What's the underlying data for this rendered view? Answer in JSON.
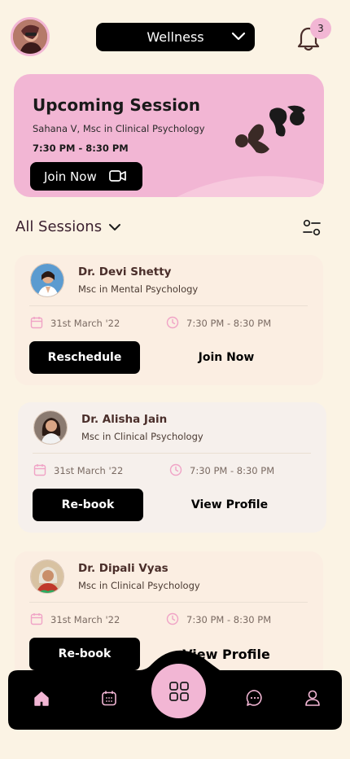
{
  "header": {
    "category": "Wellness",
    "notification_count": "3"
  },
  "upcoming": {
    "title": "Upcoming Session",
    "subtitle": "Sahana V, Msc in Clinical Psychology",
    "time": "7:30 PM - 8:30 PM",
    "join_label": "Join Now"
  },
  "sessions": {
    "label": "All Sessions",
    "items": [
      {
        "name": "Dr. Devi Shetty",
        "qualification": "Msc in Mental Psychology",
        "date": "31st March '22",
        "time": "7:30 PM - 8:30 PM",
        "primary": "Reschedule",
        "secondary": "Join Now"
      },
      {
        "name": "Dr. Alisha Jain",
        "qualification": "Msc in Clinical Psychology",
        "date": "31st March '22",
        "time": "7:30 PM - 8:30 PM",
        "primary": "Re-book",
        "secondary": "View Profile"
      },
      {
        "name": "Dr. Dipali Vyas",
        "qualification": "Msc in Clinical Psychology",
        "date": "31st March '22",
        "time": "7:30 PM - 8:30 PM",
        "primary": "Re-book",
        "secondary": "View Profile"
      }
    ]
  },
  "nav": {
    "items": [
      "home-icon",
      "calendar-icon",
      "grid-icon",
      "chat-icon",
      "profile-icon"
    ]
  },
  "colors": {
    "background": "#fbf3e4",
    "accent_pink": "#f2b6d4",
    "dark": "#000000"
  }
}
